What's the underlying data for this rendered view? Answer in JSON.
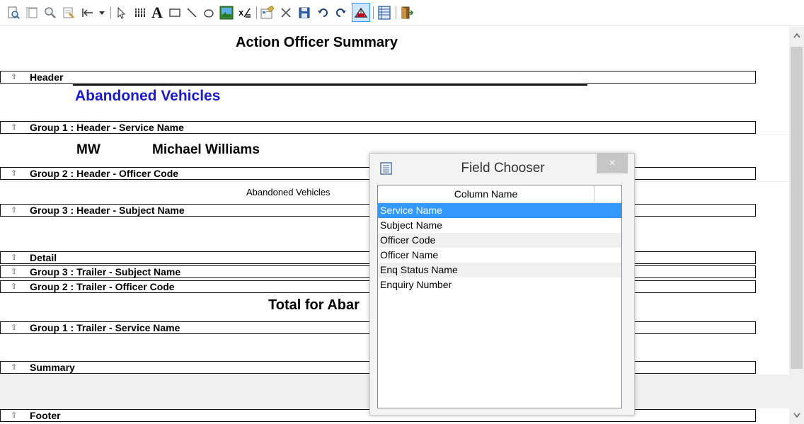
{
  "toolbar": {
    "icons": [
      "print-preview-icon",
      "page-setup-icon",
      "zoom-icon",
      "properties-icon",
      "align-left-icon",
      "dropdown-arrow-icon",
      "pointer-icon",
      "field-icon",
      "text-icon",
      "rectangle-icon",
      "line-icon",
      "ellipse-icon",
      "picture-icon",
      "calculated-field-icon",
      "report-settings-icon",
      "delete-icon",
      "save-icon",
      "undo-icon",
      "redo-icon",
      "field-chooser-icon",
      "grid-icon",
      "exit-icon"
    ]
  },
  "report": {
    "title": "Action Officer Summary",
    "bands": {
      "header": "Header",
      "group1_header": "Group 1 : Header - Service Name",
      "group2_header": "Group 2 : Header - Officer Code",
      "group3_header": "Group 3 : Header - Subject Name",
      "detail": "Detail",
      "group3_trailer": "Group 3 : Trailer - Subject Name",
      "group2_trailer": "Group 2 : Trailer - Officer Code",
      "group1_trailer": "Group 1 : Trailer - Service Name",
      "summary": "Summary",
      "footer": "Footer"
    },
    "service_name": "Abandoned Vehicles",
    "officer_code": "MW",
    "officer_name": "Michael Williams",
    "subject_name": "Abandoned Vehicles",
    "total_text": "Total for Abar",
    "band_arrow": "⇧"
  },
  "field_chooser": {
    "title": "Field Chooser",
    "close_label": "×",
    "column_header": "Column Name",
    "fields": [
      "Service Name",
      "Subject Name",
      "Officer Code",
      "Officer Name",
      "Enq Status Name",
      "Enquiry Number"
    ],
    "selected": "Service Name"
  },
  "colors": {
    "accent_blue": "#1a1acc",
    "selection": "#3399ff"
  }
}
